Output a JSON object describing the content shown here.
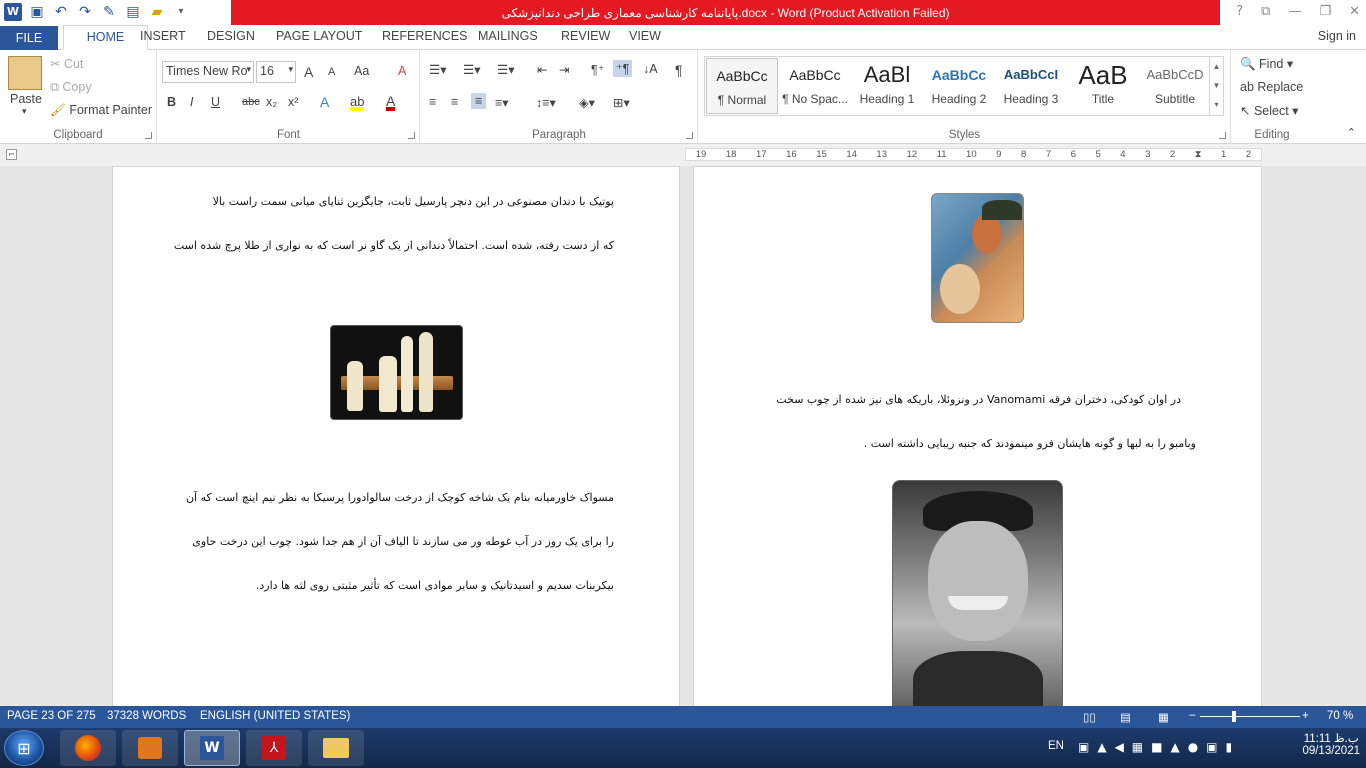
{
  "window": {
    "title": "پایاننامه کارشناسی معماری طراحی دندانپزشکی.docx - Word (Product Activation Failed)",
    "controls": [
      "?",
      "❐",
      "—",
      "❐",
      "✕"
    ]
  },
  "qat": {
    "logo": "W",
    "save": "💾",
    "undo": "↶",
    "redo": "↷"
  },
  "tabs": {
    "file": "FILE",
    "home": "HOME",
    "insert": "INSERT",
    "design": "DESIGN",
    "page_layout": "PAGE LAYOUT",
    "references": "REFERENCES",
    "mailings": "MAILINGS",
    "review": "REVIEW",
    "view": "VIEW",
    "signin": "Sign in"
  },
  "clipboard": {
    "paste": "Paste",
    "cut": "Cut",
    "copy": "Copy",
    "format_painter": "Format Painter",
    "label": "Clipboard"
  },
  "font": {
    "family": "Times New Ro",
    "size": "16",
    "label": "Font",
    "bold": "B",
    "italic": "I",
    "underline": "U",
    "strike": "abc",
    "sub": "x₂",
    "sup": "x²",
    "grow": "A",
    "shrink": "A",
    "case": "Aa",
    "clear": "A",
    "font_color": "#c00000",
    "highlight_color": "#ffff00"
  },
  "paragraph": {
    "label": "Paragraph",
    "pilcrow": "¶"
  },
  "styles": {
    "label": "Styles",
    "items": [
      {
        "sample": "AaBbCc",
        "name": "¶ Normal"
      },
      {
        "sample": "AaBbCc",
        "name": "¶ No Spac..."
      },
      {
        "sample": "AaBl",
        "name": "Heading 1"
      },
      {
        "sample": "AaBbCc",
        "name": "Heading 2"
      },
      {
        "sample": "AaBbCcI",
        "name": "Heading 3"
      },
      {
        "sample": "AaB",
        "name": "Title"
      },
      {
        "sample": "AaBbCcD",
        "name": "Subtitle"
      }
    ]
  },
  "editing": {
    "find": "Find",
    "replace": "Replace",
    "select": "Select",
    "label": "Editing"
  },
  "ruler": {
    "ticks": [
      "19",
      "18",
      "17",
      "16",
      "15",
      "14",
      "13",
      "12",
      "11",
      "10",
      "9",
      "8",
      "7",
      "6",
      "5",
      "4",
      "3",
      "2",
      "1",
      "1",
      "2"
    ]
  },
  "document": {
    "left_page": {
      "para1_line1": "پوتیک با دندان مصنوعی در این دنچر پارسیل ثابت، جایگزین ثنایای میانی سمت راست بالا",
      "para1_line2": "که از دست رفته، شده است. احتمالاً دندانی از یک گاو نر است که به نواری از طلا پرچ شده است",
      "para2_line1": "مسواک خاورمیانه بنام یک شاخه کوچک از درخت سالوادورا پرسیکا به نظر نیم اینچ است که آن",
      "para2_line2": "را برای یک روز در آب غوطه ور می سازند تا الیاف آن از هم جدا شود. چوب این درخت حاوی",
      "para2_line3": "بیکربنات سدیم و اسیدتانیک و سایر موادی است که تأثیر مثبتی روی لثه ها دارد."
    },
    "right_page": {
      "para1_line1": "در اوان کودکی، دختران فرقه Vanomami در ونزوئلا، باریکه های نیز شده از چوب سخت",
      "para1_line2": "وبامبو را به لبها و گونه هایشان فرو مینمودند که جنبه زیبایی داشته است ."
    }
  },
  "status": {
    "page": "PAGE 23 OF 275",
    "words": "37328 WORDS",
    "language": "ENGLISH (UNITED STATES)",
    "zoom": "70 %"
  },
  "taskbar": {
    "lang": "EN",
    "time": "11:11 ب.ظ",
    "date": "09/13/2021"
  }
}
